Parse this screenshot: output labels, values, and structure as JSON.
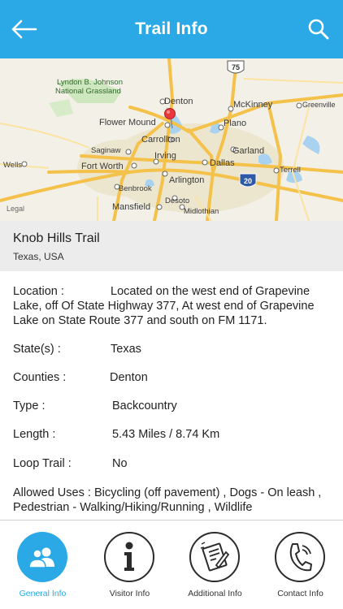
{
  "header": {
    "title": "Trail Info",
    "back_icon": "arrow-left-icon",
    "search_icon": "search-icon"
  },
  "map": {
    "labels": {
      "lbj1": "Lyndon B. Johnson",
      "lbj2": "National Grassland",
      "denton": "Denton",
      "mckinney": "McKinney",
      "greenville": "Greenville",
      "flower_mound": "Flower Mound",
      "plano": "Plano",
      "carrollton": "Carrollton",
      "saginaw": "Saginaw",
      "garland": "Garland",
      "irving": "Irving",
      "wells": "Wells",
      "fort_worth": "Fort Worth",
      "dallas": "Dallas",
      "terrell": "Terrell",
      "arlington": "Arlington",
      "benbrook": "Benbrook",
      "desoto": "Desoto",
      "mansfield": "Mansfield",
      "midlothian": "Midlothian",
      "legal": "Legal",
      "shield_75": "75",
      "shield_20": "20"
    }
  },
  "trail": {
    "name": "Knob Hills Trail",
    "location": "Texas, USA"
  },
  "details": {
    "location": {
      "label": "Location  :",
      "value": "Located on the west end of Grapevine Lake, off Of State Highway 377, At west end of Grapevine Lake on State Route 377 and south on FM 1171."
    },
    "state": {
      "label": "State(s)  :",
      "value": "Texas"
    },
    "counties": {
      "label": "Counties  :",
      "value": "Denton"
    },
    "type": {
      "label": "Type  :",
      "value": "Backcountry"
    },
    "length": {
      "label": "Length  :",
      "value": "5.43 Miles / 8.74 Km"
    },
    "loop": {
      "label": "Loop Trail  :",
      "value": "No"
    },
    "allowed": {
      "label": "Allowed Uses  :",
      "value": "Bicycling (off pavement) , Dogs - On leash , Pedestrian - Walking/Hiking/Running , Wildlife"
    }
  },
  "tabs": [
    {
      "label": "General Info",
      "icon": "users-icon",
      "active": true
    },
    {
      "label": "Visitor Info",
      "icon": "info-icon",
      "active": false
    },
    {
      "label": "Additional Info",
      "icon": "document-edit-icon",
      "active": false
    },
    {
      "label": "Contact Info",
      "icon": "phone-icon",
      "active": false
    }
  ],
  "colors": {
    "accent": "#2aa9e6",
    "header_text": "#ffffff",
    "section_bg": "#ececec"
  }
}
